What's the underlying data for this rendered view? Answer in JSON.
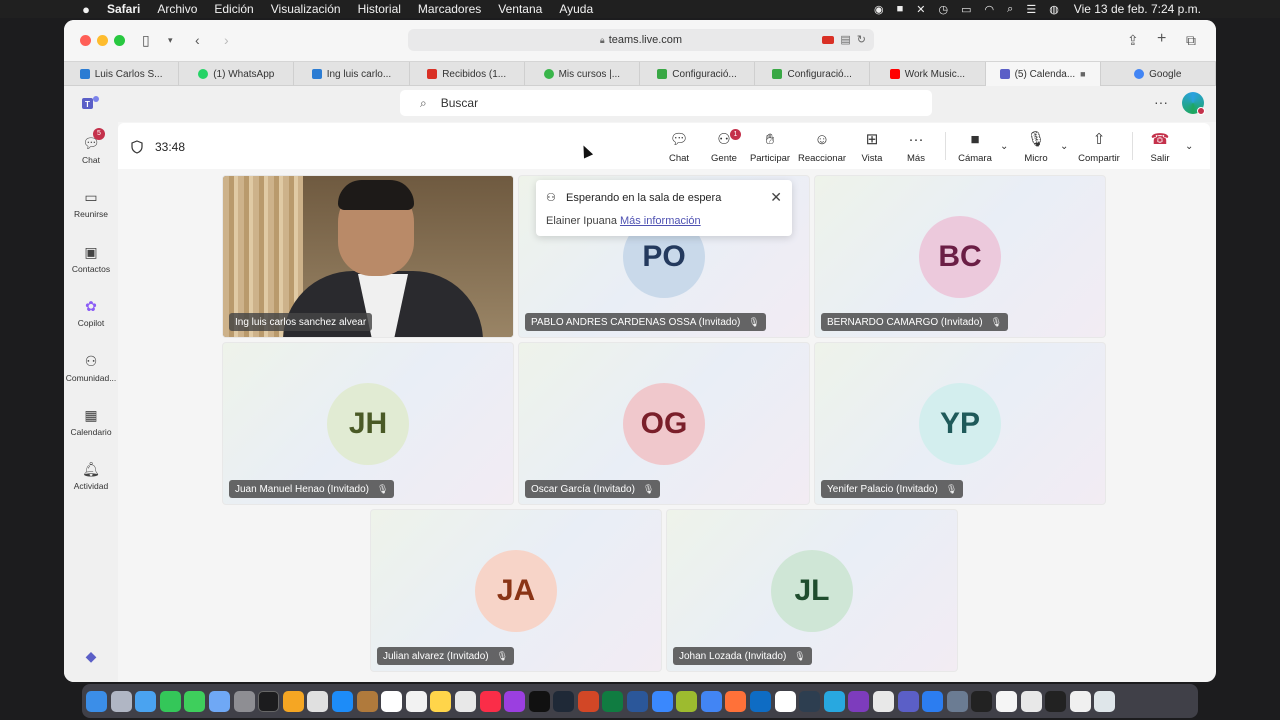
{
  "menubar": {
    "app": "Safari",
    "items": [
      "Archivo",
      "Edición",
      "Visualización",
      "Historial",
      "Marcadores",
      "Ventana",
      "Ayuda"
    ],
    "clock": "Vie 13 de feb.  7:24 p.m."
  },
  "browser": {
    "url": "teams.live.com",
    "tabs": [
      {
        "label": "Luis Carlos S...",
        "color": "#2b7cd3"
      },
      {
        "label": "(1) WhatsApp",
        "color": "#25d366"
      },
      {
        "label": "Ing luis carlo...",
        "color": "#2b7cd3"
      },
      {
        "label": "Recibidos (1...",
        "color": "#d93025"
      },
      {
        "label": "Mis cursos |...",
        "color": "#39b54a"
      },
      {
        "label": "Configuració...",
        "color": "#39a845"
      },
      {
        "label": "Configuració...",
        "color": "#39a845"
      },
      {
        "label": "Work Music...",
        "color": "#ff0000"
      },
      {
        "label": "(5) Calenda...",
        "color": "#5b5fc7"
      },
      {
        "label": "Google",
        "color": "#4285f4"
      }
    ]
  },
  "teams": {
    "search_placeholder": "Buscar",
    "rail": [
      {
        "label": "Chat",
        "icon": "chat-icon",
        "badge": "5"
      },
      {
        "label": "Reunirse",
        "icon": "video-icon"
      },
      {
        "label": "Contactos",
        "icon": "contacts-icon"
      },
      {
        "label": "Copilot",
        "icon": "copilot-icon"
      },
      {
        "label": "Comunidad...",
        "icon": "community-icon"
      },
      {
        "label": "Calendario",
        "icon": "calendar-icon"
      },
      {
        "label": "Actividad",
        "icon": "bell-icon"
      }
    ]
  },
  "meeting": {
    "timer": "33:48",
    "controls": {
      "chat": "Chat",
      "people": "Gente",
      "people_badge": "1",
      "raise": "Participar",
      "react": "Reaccionar",
      "view": "Vista",
      "more": "Más",
      "camera": "Cámara",
      "mic": "Micro",
      "share": "Compartir",
      "leave": "Salir"
    },
    "waiting_notice": {
      "title": "Esperando en la sala de espera",
      "name": "Elainer Ipuana",
      "link": "Más información"
    },
    "participants": [
      {
        "name": "Ing luis carlos sanchez alvear",
        "video": true
      },
      {
        "name": "PABLO ANDRES CARDENAS OSSA (Invitado)",
        "initials": "PO",
        "bg": "#c9d9ea",
        "fg": "#243a5e"
      },
      {
        "name": "BERNARDO CAMARGO (Invitado)",
        "initials": "BC",
        "bg": "#ecc9dc",
        "fg": "#6b1e45"
      },
      {
        "name": "Juan Manuel Henao (Invitado)",
        "initials": "JH",
        "bg": "#e1ebd3",
        "fg": "#4a5a26"
      },
      {
        "name": "Oscar García (Invitado)",
        "initials": "OG",
        "bg": "#f0c8cc",
        "fg": "#7a1f2a"
      },
      {
        "name": "Yenifer Palacio (Invitado)",
        "initials": "YP",
        "bg": "#d3eeee",
        "fg": "#1f5a5a"
      },
      {
        "name": "Julian alvarez (Invitado)",
        "initials": "JA",
        "bg": "#f7d4c8",
        "fg": "#8a3416"
      },
      {
        "name": "Johan Lozada (Invitado)",
        "initials": "JL",
        "bg": "#cfe6d6",
        "fg": "#1f4d2e"
      }
    ]
  }
}
